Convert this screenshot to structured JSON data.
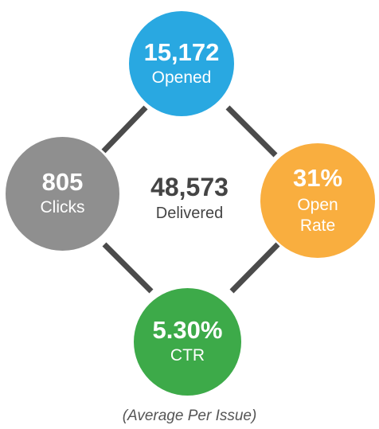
{
  "diagram": {
    "nodes": {
      "opened": {
        "value": "15,172",
        "label": "Opened",
        "color": "#29a8e1"
      },
      "clicks": {
        "value": "805",
        "label": "Clicks",
        "color": "#8f8f8f"
      },
      "open_rate": {
        "value": "31%",
        "label": "Open Rate",
        "color": "#f9ae3f"
      },
      "ctr": {
        "value": "5.30%",
        "label": "CTR",
        "color": "#3daa49"
      }
    },
    "center": {
      "value": "48,573",
      "label": "Delivered"
    },
    "connector_color": "#4b4b4b",
    "footnote": "(Average Per Issue)"
  }
}
